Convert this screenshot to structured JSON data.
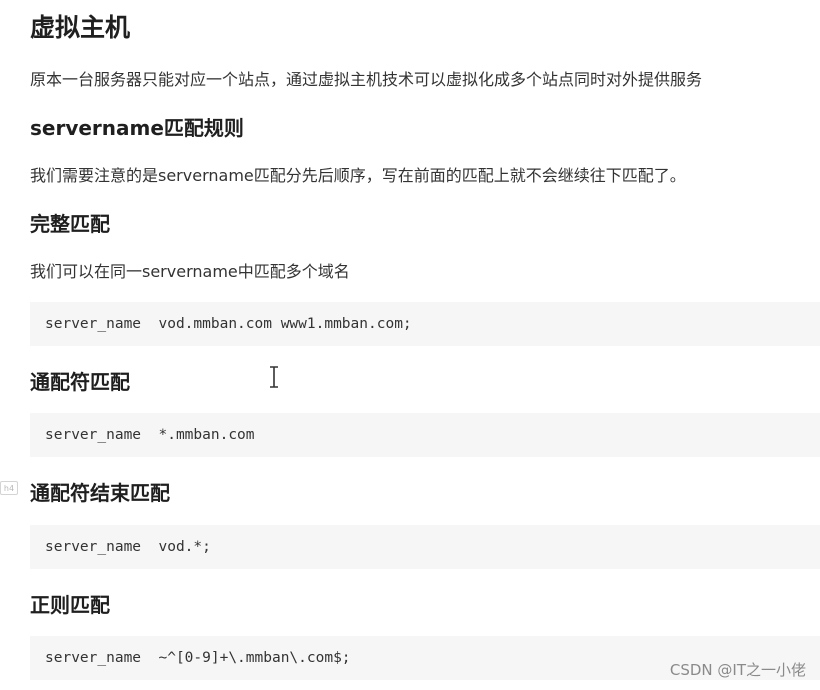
{
  "title": "虚拟主机",
  "intro": "原本一台服务器只能对应一个站点，通过虚拟主机技术可以虚拟化成多个站点同时对外提供服务",
  "section_servername": {
    "heading": "servername匹配规则",
    "text": "我们需要注意的是servername匹配分先后顺序，写在前面的匹配上就不会继续往下匹配了。"
  },
  "section_exact": {
    "heading": "完整匹配",
    "text": "我们可以在同一servername中匹配多个域名",
    "code": "server_name  vod.mmban.com www1.mmban.com;"
  },
  "section_wildcard": {
    "heading": "通配符匹配",
    "code": "server_name  *.mmban.com"
  },
  "section_wildcard_end": {
    "heading": "通配符结束匹配",
    "code": "server_name  vod.*;",
    "anchor_label": "h4"
  },
  "section_regex": {
    "heading": "正则匹配",
    "code": "server_name  ~^[0-9]+\\.mmban\\.com$;"
  },
  "watermark": "CSDN @IT之一小佬"
}
